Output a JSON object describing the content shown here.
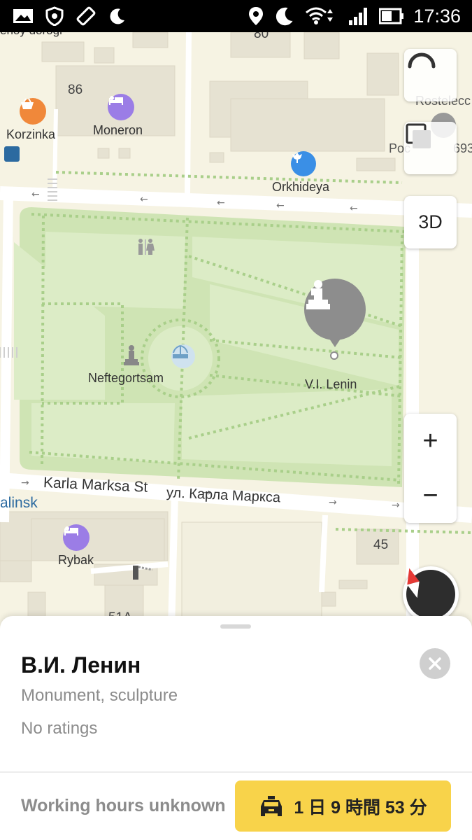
{
  "status_bar": {
    "time": "17:36",
    "icons": [
      "gallery-icon",
      "shield-icon",
      "screen-rotation-icon",
      "moon-icon",
      "location-icon",
      "moon-icon",
      "wifi-icon",
      "signal-icon",
      "battery-icon"
    ]
  },
  "map": {
    "building_numbers": [
      "80",
      "86",
      "45",
      "51A"
    ],
    "poi_labels": {
      "korzinka": "Korzinka",
      "moneron": "Moneron",
      "orkhideya": "Orkhideya",
      "neftegortsam": "Neftegortsam",
      "lenin": "V.I. Lenin",
      "rybak": "Rybak",
      "rostelecom": "Rostelecc",
      "post": "Poc",
      "post_num": "693",
      "city": "alinsk",
      "road_top": "enoy dorogi"
    },
    "street": {
      "latin": "Karla Marksa St",
      "cyrillic": "ул. Карла Маркса"
    },
    "controls": {
      "btn_3d": "3D",
      "zoom_in": "+",
      "zoom_out": "−"
    }
  },
  "card": {
    "title": "В.И. Ленин",
    "category": "Monument, sculpture",
    "rating": "No ratings",
    "hours": "Working hours unknown",
    "taxi_label": "1 日 9 時間 53 分"
  },
  "colors": {
    "map_bg": "#f6f3e3",
    "park": "#cfe4b4",
    "taxi_button": "#f8d34a",
    "hotel_poi": "#9b7de6",
    "shop_poi": "#f0883a",
    "flower_poi": "#3a8fe6"
  }
}
